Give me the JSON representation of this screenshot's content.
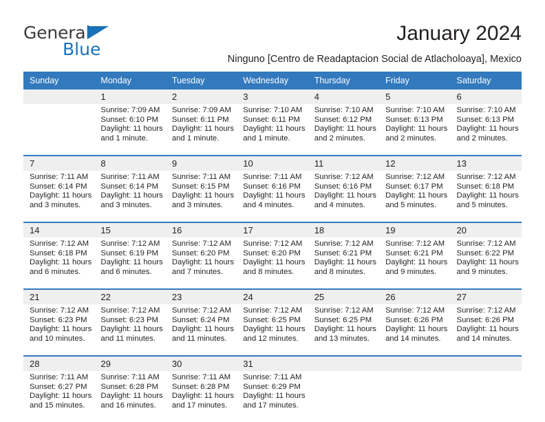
{
  "brand": {
    "name_part1": "General",
    "name_part2": "Blue",
    "triangle_icon": "triangle-icon"
  },
  "header": {
    "title": "January 2024",
    "subtitle": "Ninguno [Centro de Readaptacion Social de Atlacholoaya], Mexico"
  },
  "colors": {
    "header_blue": "#3279bd",
    "brand_blue": "#1a72b8",
    "daynum_band": "#efefef",
    "text": "#231f20"
  },
  "calendar": {
    "weekday_headers": [
      "Sunday",
      "Monday",
      "Tuesday",
      "Wednesday",
      "Thursday",
      "Friday",
      "Saturday"
    ],
    "weeks": [
      [
        {
          "day": "",
          "lines": [
            "",
            "",
            "",
            ""
          ]
        },
        {
          "day": "1",
          "lines": [
            "Sunrise: 7:09 AM",
            "Sunset: 6:10 PM",
            "Daylight: 11 hours",
            "and 1 minute."
          ]
        },
        {
          "day": "2",
          "lines": [
            "Sunrise: 7:09 AM",
            "Sunset: 6:11 PM",
            "Daylight: 11 hours",
            "and 1 minute."
          ]
        },
        {
          "day": "3",
          "lines": [
            "Sunrise: 7:10 AM",
            "Sunset: 6:11 PM",
            "Daylight: 11 hours",
            "and 1 minute."
          ]
        },
        {
          "day": "4",
          "lines": [
            "Sunrise: 7:10 AM",
            "Sunset: 6:12 PM",
            "Daylight: 11 hours",
            "and 2 minutes."
          ]
        },
        {
          "day": "5",
          "lines": [
            "Sunrise: 7:10 AM",
            "Sunset: 6:13 PM",
            "Daylight: 11 hours",
            "and 2 minutes."
          ]
        },
        {
          "day": "6",
          "lines": [
            "Sunrise: 7:10 AM",
            "Sunset: 6:13 PM",
            "Daylight: 11 hours",
            "and 2 minutes."
          ]
        }
      ],
      [
        {
          "day": "7",
          "lines": [
            "Sunrise: 7:11 AM",
            "Sunset: 6:14 PM",
            "Daylight: 11 hours",
            "and 3 minutes."
          ]
        },
        {
          "day": "8",
          "lines": [
            "Sunrise: 7:11 AM",
            "Sunset: 6:14 PM",
            "Daylight: 11 hours",
            "and 3 minutes."
          ]
        },
        {
          "day": "9",
          "lines": [
            "Sunrise: 7:11 AM",
            "Sunset: 6:15 PM",
            "Daylight: 11 hours",
            "and 3 minutes."
          ]
        },
        {
          "day": "10",
          "lines": [
            "Sunrise: 7:11 AM",
            "Sunset: 6:16 PM",
            "Daylight: 11 hours",
            "and 4 minutes."
          ]
        },
        {
          "day": "11",
          "lines": [
            "Sunrise: 7:12 AM",
            "Sunset: 6:16 PM",
            "Daylight: 11 hours",
            "and 4 minutes."
          ]
        },
        {
          "day": "12",
          "lines": [
            "Sunrise: 7:12 AM",
            "Sunset: 6:17 PM",
            "Daylight: 11 hours",
            "and 5 minutes."
          ]
        },
        {
          "day": "13",
          "lines": [
            "Sunrise: 7:12 AM",
            "Sunset: 6:18 PM",
            "Daylight: 11 hours",
            "and 5 minutes."
          ]
        }
      ],
      [
        {
          "day": "14",
          "lines": [
            "Sunrise: 7:12 AM",
            "Sunset: 6:18 PM",
            "Daylight: 11 hours",
            "and 6 minutes."
          ]
        },
        {
          "day": "15",
          "lines": [
            "Sunrise: 7:12 AM",
            "Sunset: 6:19 PM",
            "Daylight: 11 hours",
            "and 6 minutes."
          ]
        },
        {
          "day": "16",
          "lines": [
            "Sunrise: 7:12 AM",
            "Sunset: 6:20 PM",
            "Daylight: 11 hours",
            "and 7 minutes."
          ]
        },
        {
          "day": "17",
          "lines": [
            "Sunrise: 7:12 AM",
            "Sunset: 6:20 PM",
            "Daylight: 11 hours",
            "and 8 minutes."
          ]
        },
        {
          "day": "18",
          "lines": [
            "Sunrise: 7:12 AM",
            "Sunset: 6:21 PM",
            "Daylight: 11 hours",
            "and 8 minutes."
          ]
        },
        {
          "day": "19",
          "lines": [
            "Sunrise: 7:12 AM",
            "Sunset: 6:21 PM",
            "Daylight: 11 hours",
            "and 9 minutes."
          ]
        },
        {
          "day": "20",
          "lines": [
            "Sunrise: 7:12 AM",
            "Sunset: 6:22 PM",
            "Daylight: 11 hours",
            "and 9 minutes."
          ]
        }
      ],
      [
        {
          "day": "21",
          "lines": [
            "Sunrise: 7:12 AM",
            "Sunset: 6:23 PM",
            "Daylight: 11 hours",
            "and 10 minutes."
          ]
        },
        {
          "day": "22",
          "lines": [
            "Sunrise: 7:12 AM",
            "Sunset: 6:23 PM",
            "Daylight: 11 hours",
            "and 11 minutes."
          ]
        },
        {
          "day": "23",
          "lines": [
            "Sunrise: 7:12 AM",
            "Sunset: 6:24 PM",
            "Daylight: 11 hours",
            "and 11 minutes."
          ]
        },
        {
          "day": "24",
          "lines": [
            "Sunrise: 7:12 AM",
            "Sunset: 6:25 PM",
            "Daylight: 11 hours",
            "and 12 minutes."
          ]
        },
        {
          "day": "25",
          "lines": [
            "Sunrise: 7:12 AM",
            "Sunset: 6:25 PM",
            "Daylight: 11 hours",
            "and 13 minutes."
          ]
        },
        {
          "day": "26",
          "lines": [
            "Sunrise: 7:12 AM",
            "Sunset: 6:26 PM",
            "Daylight: 11 hours",
            "and 14 minutes."
          ]
        },
        {
          "day": "27",
          "lines": [
            "Sunrise: 7:12 AM",
            "Sunset: 6:26 PM",
            "Daylight: 11 hours",
            "and 14 minutes."
          ]
        }
      ],
      [
        {
          "day": "28",
          "lines": [
            "Sunrise: 7:11 AM",
            "Sunset: 6:27 PM",
            "Daylight: 11 hours",
            "and 15 minutes."
          ]
        },
        {
          "day": "29",
          "lines": [
            "Sunrise: 7:11 AM",
            "Sunset: 6:28 PM",
            "Daylight: 11 hours",
            "and 16 minutes."
          ]
        },
        {
          "day": "30",
          "lines": [
            "Sunrise: 7:11 AM",
            "Sunset: 6:28 PM",
            "Daylight: 11 hours",
            "and 17 minutes."
          ]
        },
        {
          "day": "31",
          "lines": [
            "Sunrise: 7:11 AM",
            "Sunset: 6:29 PM",
            "Daylight: 11 hours",
            "and 17 minutes."
          ]
        },
        {
          "day": "",
          "lines": [
            "",
            "",
            "",
            ""
          ]
        },
        {
          "day": "",
          "lines": [
            "",
            "",
            "",
            ""
          ]
        },
        {
          "day": "",
          "lines": [
            "",
            "",
            "",
            ""
          ]
        }
      ]
    ]
  }
}
